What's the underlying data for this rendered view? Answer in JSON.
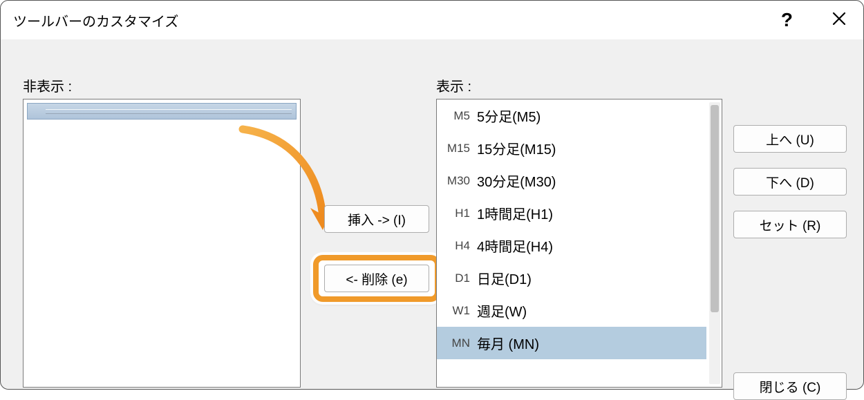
{
  "title": "ツールバーのカスタマイズ",
  "help_symbol": "?",
  "labels": {
    "hidden": "非表示 :",
    "visible": "表示 :"
  },
  "buttons": {
    "insert": "挿入 -> (I)",
    "remove": "<- 削除 (e)",
    "up": "上へ (U)",
    "down": "下へ (D)",
    "set": "セット (R)",
    "close": "閉じる (C)"
  },
  "visible_items": [
    {
      "code": "M5",
      "label": "5分足(M5)",
      "selected": false
    },
    {
      "code": "M15",
      "label": "15分足(M15)",
      "selected": false
    },
    {
      "code": "M30",
      "label": "30分足(M30)",
      "selected": false
    },
    {
      "code": "H1",
      "label": "1時間足(H1)",
      "selected": false
    },
    {
      "code": "H4",
      "label": "4時間足(H4)",
      "selected": false
    },
    {
      "code": "D1",
      "label": "日足(D1)",
      "selected": false
    },
    {
      "code": "W1",
      "label": "週足(W)",
      "selected": false
    },
    {
      "code": "MN",
      "label": "毎月 (MN)",
      "selected": true
    }
  ]
}
